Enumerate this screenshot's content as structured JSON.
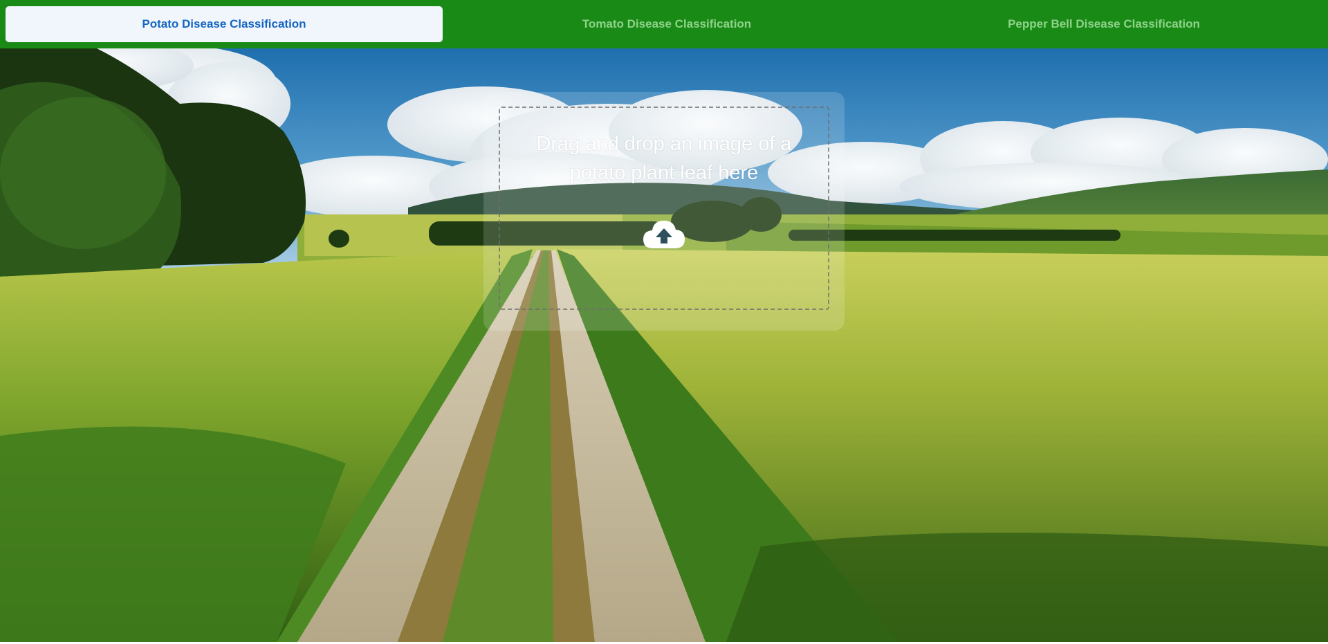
{
  "tabs": [
    {
      "label": "Potato Disease Classification",
      "active": true
    },
    {
      "label": "Tomato Disease Classification",
      "active": false
    },
    {
      "label": "Pepper Bell Disease Classification",
      "active": false
    }
  ],
  "dropzone": {
    "prompt": "Drag and drop an image of a potato plant leaf here",
    "icon": "cloud-upload-icon"
  },
  "background": {
    "description_icon": "landscape-background"
  },
  "colors": {
    "tabbar": "#1a8a16",
    "active_tab_bg": "#f1f6fd",
    "active_tab_text": "#1565c0",
    "inactive_tab_text": "#8ed38a"
  }
}
